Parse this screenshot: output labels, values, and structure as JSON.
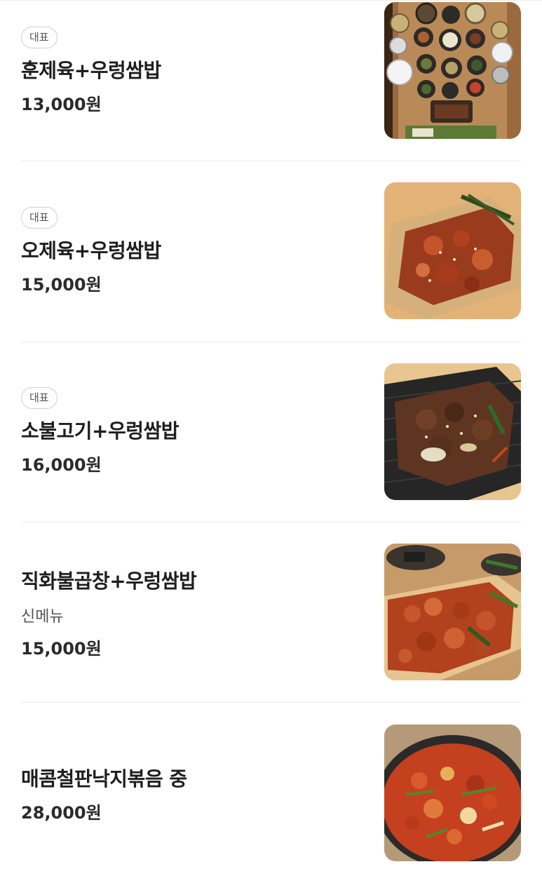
{
  "menu": {
    "items": [
      {
        "badge": "대표",
        "name": "훈제육+우렁쌈밥",
        "description": "",
        "price": "13,000원",
        "image_icon": "table-set-meal-photo"
      },
      {
        "badge": "대표",
        "name": "오제육+우렁쌈밥",
        "description": "",
        "price": "15,000원",
        "image_icon": "spicy-pork-platter-photo"
      },
      {
        "badge": "대표",
        "name": "소불고기+우렁쌈밥",
        "description": "",
        "price": "16,000원",
        "image_icon": "beef-bulgogi-photo"
      },
      {
        "badge": "",
        "name": "직화불곱창+우렁쌈밥",
        "description": "신메뉴",
        "price": "15,000원",
        "image_icon": "grilled-gopchang-photo"
      },
      {
        "badge": "",
        "name": "매콤철판낙지볶음 중",
        "description": "",
        "price": "28,000원",
        "image_icon": "octopus-stirfry-photo"
      }
    ]
  },
  "colors": {
    "badge_border": "#cfcfcf",
    "divider": "#ebebeb",
    "text_primary": "#1e1e1e",
    "text_secondary": "#555555"
  }
}
